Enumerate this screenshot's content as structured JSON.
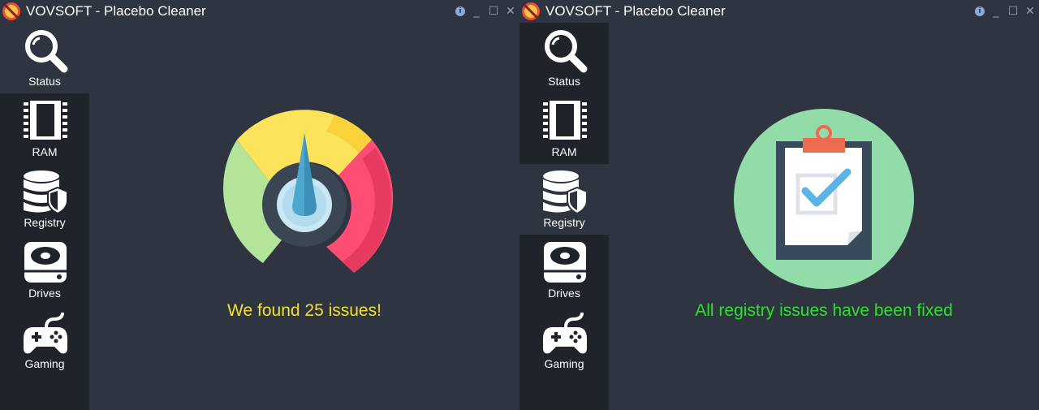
{
  "colors": {
    "background": "#2e3440",
    "sidebar": "#1f242b",
    "found_text": "#f0e130",
    "fixed_text": "#2ee02e",
    "gauge_green": "#b4e39a",
    "gauge_yellow": "#fde35b",
    "gauge_red": "#ff4d73",
    "check_blue": "#5ab4e6",
    "circle_green": "#92dca9"
  },
  "windows": [
    {
      "title": "VOVSOFT - Placebo Cleaner",
      "active_nav": "Status",
      "message": "We found 25 issues!"
    },
    {
      "title": "VOVSOFT - Placebo Cleaner",
      "active_nav": "Registry",
      "message": "All registry issues have been fixed"
    }
  ],
  "nav": [
    {
      "label": "Status",
      "icon": "magnifier-icon"
    },
    {
      "label": "RAM",
      "icon": "ram-chip-icon"
    },
    {
      "label": "Registry",
      "icon": "database-shield-icon"
    },
    {
      "label": "Drives",
      "icon": "hard-drive-icon"
    },
    {
      "label": "Gaming",
      "icon": "gamepad-icon"
    }
  ],
  "titlebar_buttons": {
    "info": "i",
    "minimize": "_",
    "maximize": "☐",
    "close": "✕"
  }
}
